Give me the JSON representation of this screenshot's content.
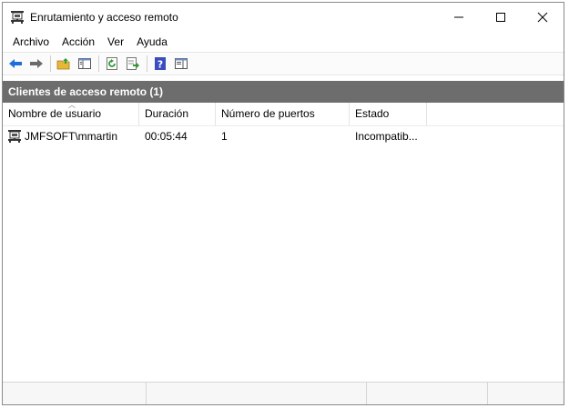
{
  "window": {
    "title": "Enrutamiento y acceso remoto",
    "app_icon": "rras-server-icon",
    "controls": {
      "minimize": "minimize-icon",
      "maximize": "maximize-icon",
      "close": "close-icon"
    }
  },
  "menubar": {
    "items": [
      {
        "label": "Archivo"
      },
      {
        "label": "Acción"
      },
      {
        "label": "Ver"
      },
      {
        "label": "Ayuda"
      }
    ]
  },
  "toolbar": {
    "buttons": [
      "back-arrow-icon",
      "forward-arrow-icon",
      "up-folder-icon",
      "show-hide-tree-icon",
      "refresh-icon",
      "export-list-icon",
      "help-icon",
      "properties-pane-icon"
    ],
    "colors": {
      "arrow": "#1e6fd9",
      "folder": "#e8b73a",
      "refresh": "#2f9a2f",
      "help": "#3b4cc0"
    }
  },
  "panel": {
    "title": "Clientes de acceso remoto (1)",
    "band_color": "#6d6d6d",
    "columns": [
      "Nombre de usuario",
      "Duración",
      "Número de puertos",
      "Estado"
    ],
    "rows": [
      {
        "user": "JMFSOFT\\mmartin",
        "duration": "00:05:44",
        "ports": "1",
        "status": "Incompatib..."
      }
    ]
  }
}
